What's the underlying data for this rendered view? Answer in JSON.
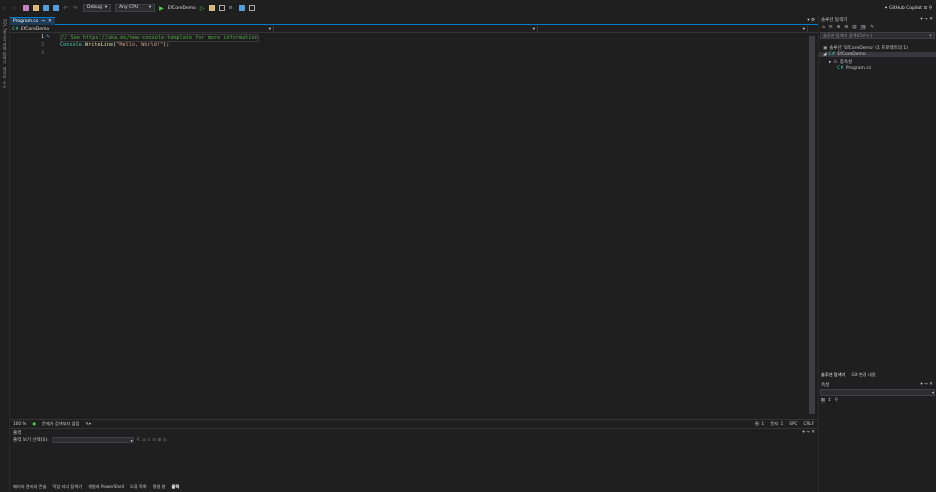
{
  "toolbar": {
    "config": "Debug",
    "platform": "Any CPU",
    "startup_project": "EfCoreDemo",
    "copilot": "GitHub Copilot"
  },
  "sidebar": {
    "items": [
      "SQL Server 개체 탐색기",
      "데이터 소스"
    ]
  },
  "editor": {
    "tab_label": "Program.cs",
    "nav_project": "EfCoreDemo",
    "lines": [
      {
        "num": "1",
        "text": "// See https://aka.ms/new-console-template for more information"
      },
      {
        "num": "2",
        "text_prefix": "Console.",
        "text_method": "WriteLine",
        "text_args_open": "(",
        "text_string": "\"Hello, World!\"",
        "text_args_close": ");"
      },
      {
        "num": "3",
        "text": ""
      }
    ],
    "zoom": "100 %",
    "issues": "문제가 검색되지 않음",
    "position_line": "줄: 1",
    "position_char": "문자: 1",
    "insert_mode": "SPC",
    "line_ending": "CRLF"
  },
  "output": {
    "title": "출력",
    "source_label": "출력 보기 선택(S):"
  },
  "bottom_tabs": [
    "패키지 관리자 콘솔",
    "작업 러너 탐색기",
    "개발자 PowerShell",
    "오류 목록",
    "명령 창",
    "출력"
  ],
  "solution_explorer": {
    "title": "솔루션 탐색기",
    "search_placeholder": "솔루션 탐색기 검색(Ctrl+;)",
    "solution": "솔루션 'EfCoreDemo' (1 프로젝트의 1)",
    "project": "EfCoreDemo",
    "dependencies": "종속성",
    "file": "Program.cs",
    "bottom_tab_1": "솔루션 탐색기",
    "bottom_tab_2": "Git 변경 내용"
  },
  "properties": {
    "title": "속성"
  },
  "colors": {
    "accent": "#007acc",
    "comment": "#57a64a",
    "string": "#d69d85",
    "method": "#dcdcaa",
    "class": "#4ec9b0",
    "link": "#569cd6"
  }
}
